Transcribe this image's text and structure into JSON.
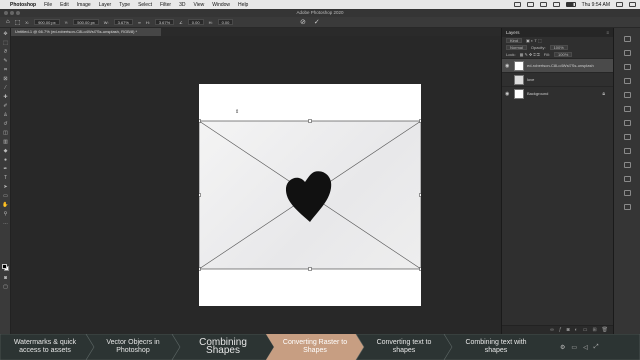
{
  "menubar": {
    "app": "Photoshop",
    "items": [
      "File",
      "Edit",
      "Image",
      "Layer",
      "Type",
      "Select",
      "Filter",
      "3D",
      "View",
      "Window",
      "Help"
    ],
    "clock": "Thu 9:54 AM"
  },
  "window": {
    "title": "Adobe Photoshop 2020"
  },
  "options": {
    "x": "900.00 px",
    "y": "500.00 px",
    "w": "3.67%",
    "h": "3.67%",
    "angle": "0.00",
    "h_skew": "0.00"
  },
  "document": {
    "tab": "Untitled-1 @ 66.7% (ed-robertson-C8Lo4Wsi7Ss-unsplash, RGB/8) *"
  },
  "layers_panel": {
    "title": "Layers",
    "kind": "Kind",
    "blend_mode": "Normal",
    "opacity_label": "Opacity:",
    "opacity": "100%",
    "lock_label": "Lock:",
    "fill_label": "Fill:",
    "fill": "100%",
    "layers": [
      {
        "name": "ed-robertson-C8Lo4Wsi7Ss-unsplash",
        "selected": true
      },
      {
        "name": "love",
        "selected": false
      },
      {
        "name": "Background",
        "selected": false
      }
    ]
  },
  "colors": {
    "accent_nav_active": "#c79e82",
    "nav_bg": "#2c3433"
  },
  "lessons": [
    {
      "label": "Watermarks & quick access to assets"
    },
    {
      "label": "Vector Objecrs in Photoshop"
    },
    {
      "label": "Combining Shapes"
    },
    {
      "label": "Converting Raster to Shapes",
      "active": true
    },
    {
      "label": "Converting text to shapes"
    },
    {
      "label": "Combining text with shapes"
    }
  ]
}
